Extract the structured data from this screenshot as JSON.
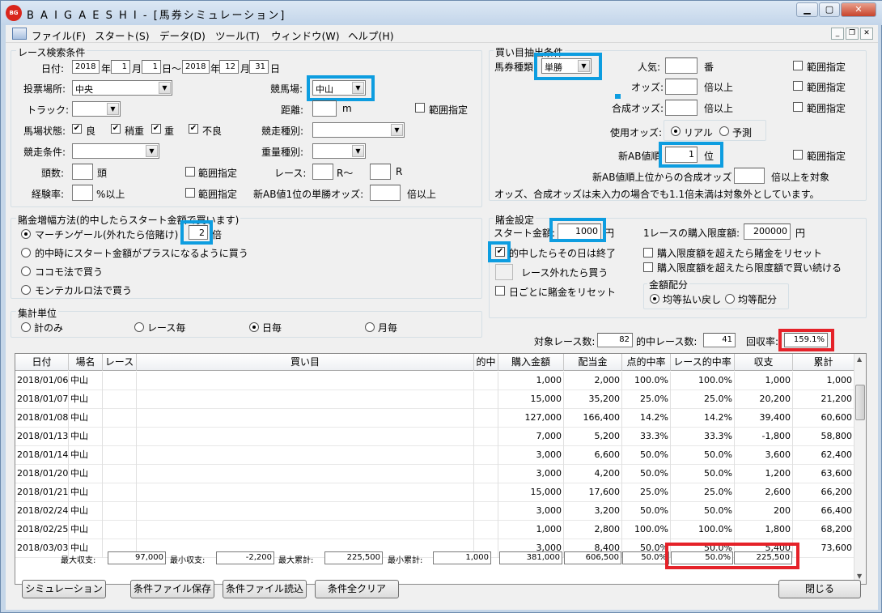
{
  "window": {
    "title": "B A I G A E S H I - [馬券シミュレーション]",
    "logo_text": "BAIGAESHI"
  },
  "menu": [
    "ファイル(F)",
    "スタート(S)",
    "データ(D)",
    "ツール(T)",
    "ウィンドウ(W)",
    "ヘルプ(H)"
  ],
  "race_search": {
    "title": "レース検索条件",
    "date_label": "日付:",
    "from": {
      "year": "2018",
      "y": "年",
      "month": "1",
      "m": "月",
      "day": "1",
      "d": "日〜"
    },
    "to": {
      "year": "2018",
      "y": "年",
      "month": "12",
      "m": "月",
      "day": "31",
      "d": "日"
    },
    "venue_label": "投票場所:",
    "venue": "中央",
    "racecourse_label": "競馬場:",
    "racecourse": "中山",
    "track_label": "トラック:",
    "track": "",
    "distance_label": "距離:",
    "distance": "",
    "distance_unit": "m",
    "range_label": "範囲指定",
    "condition_label": "馬場状態:",
    "conditions": [
      {
        "label": "良",
        "checked": true
      },
      {
        "label": "稍重",
        "checked": true
      },
      {
        "label": "重",
        "checked": true
      },
      {
        "label": "不良",
        "checked": true
      }
    ],
    "race_type_label": "競走種別:",
    "race_type": "",
    "race_cond_label": "競走条件:",
    "race_cond": "",
    "weight_label": "重量種別:",
    "weight": "",
    "heads_label": "頭数:",
    "heads": "",
    "heads_unit": "頭",
    "race_label": "レース:",
    "race_from": "",
    "race_mid": "R〜",
    "race_to": "",
    "race_unit": "R",
    "exp_label": "経験率:",
    "exp": "",
    "exp_unit": "%以上",
    "newab_odds_label": "新AB値1位の単勝オッズ:",
    "newab_odds": "",
    "newab_odds_unit": "倍以上"
  },
  "bet_extract": {
    "title": "買い目抽出条件",
    "type_label": "馬券種類",
    "type": "単勝",
    "pop_label": "人気:",
    "pop": "",
    "pop_unit": "番",
    "odds_label": "オッズ:",
    "odds": "",
    "odds_unit": "倍以上",
    "comp_label": "合成オッズ:",
    "comp": "",
    "comp_unit": "倍以上",
    "use_odds_label": "使用オッズ:",
    "use_real": "リアル",
    "use_pred": "予測",
    "newab_rank_label": "新AB値順",
    "newab_rank": "1",
    "newab_rank_unit": "位",
    "newab_comp_label": "新AB値順上位からの合成オッズ",
    "newab_comp": "",
    "newab_comp_unit": "倍以上を対象",
    "note": "オッズ、合成オッズは未入力の場合でも1.1倍未満は対象外としています。",
    "range_label": "範囲指定"
  },
  "stake_increase": {
    "title": "賭金増幅方法(的中したらスタート金額で買います)",
    "options": [
      "マーチンゲール(外れたら倍賭け)",
      "的中時にスタート金額がプラスになるように買う",
      "ココモ法で買う",
      "モンテカルロ法で買う"
    ],
    "multiplier": "2",
    "multiplier_unit": "倍"
  },
  "stake_settings": {
    "title": "賭金設定",
    "start_label": "スタート金額:",
    "start": "1000",
    "start_unit": "円",
    "limit_label": "1レースの購入限度額:",
    "limit": "200000",
    "limit_unit": "円",
    "end_on_hit": "的中したらその日は終了",
    "race_skip": "レース外れたら買う",
    "reset_daily": "日ごとに賭金をリセット",
    "reset_over": "購入限度額を超えたら賭金をリセット",
    "keep_limit": "購入限度額を超えたら限度額で買い続ける",
    "alloc_title": "金額配分",
    "alloc_eq_return": "均等払い戻し",
    "alloc_eq": "均等配分"
  },
  "agg_unit": {
    "title": "集計単位",
    "options": [
      "計のみ",
      "レース毎",
      "日毎",
      "月毎"
    ]
  },
  "summary": {
    "target_label": "対象レース数:",
    "target": "82",
    "hit_label": "的中レース数:",
    "hit": "41",
    "return_label": "回収率:",
    "return": "159.1%"
  },
  "table": {
    "headers": [
      "日付",
      "場名",
      "レース",
      "買い目",
      "的中",
      "購入金額",
      "配当金",
      "点的中率",
      "レース的中率",
      "収支",
      "累計"
    ],
    "rows": [
      [
        "2018/01/06",
        "中山",
        "",
        "",
        "",
        "1,000",
        "2,000",
        "100.0%",
        "100.0%",
        "1,000",
        "1,000"
      ],
      [
        "2018/01/07",
        "中山",
        "",
        "",
        "",
        "15,000",
        "35,200",
        "25.0%",
        "25.0%",
        "20,200",
        "21,200"
      ],
      [
        "2018/01/08",
        "中山",
        "",
        "",
        "",
        "127,000",
        "166,400",
        "14.2%",
        "14.2%",
        "39,400",
        "60,600"
      ],
      [
        "2018/01/13",
        "中山",
        "",
        "",
        "",
        "7,000",
        "5,200",
        "33.3%",
        "33.3%",
        "-1,800",
        "58,800"
      ],
      [
        "2018/01/14",
        "中山",
        "",
        "",
        "",
        "3,000",
        "6,600",
        "50.0%",
        "50.0%",
        "3,600",
        "62,400"
      ],
      [
        "2018/01/20",
        "中山",
        "",
        "",
        "",
        "3,000",
        "4,200",
        "50.0%",
        "50.0%",
        "1,200",
        "63,600"
      ],
      [
        "2018/01/21",
        "中山",
        "",
        "",
        "",
        "15,000",
        "17,600",
        "25.0%",
        "25.0%",
        "2,600",
        "66,200"
      ],
      [
        "2018/02/24",
        "中山",
        "",
        "",
        "",
        "3,000",
        "3,200",
        "50.0%",
        "50.0%",
        "200",
        "66,400"
      ],
      [
        "2018/02/25",
        "中山",
        "",
        "",
        "",
        "1,000",
        "2,800",
        "100.0%",
        "100.0%",
        "1,800",
        "68,200"
      ],
      [
        "2018/03/03",
        "中山",
        "",
        "",
        "",
        "3,000",
        "8,400",
        "50.0%",
        "50.0%",
        "5,400",
        "73,600"
      ]
    ]
  },
  "footer": {
    "max_profit_label": "最大収支:",
    "max_profit": "97,000",
    "min_profit_label": "最小収支:",
    "min_profit": "-2,200",
    "max_cum_label": "最大累計:",
    "max_cum": "225,500",
    "min_cum_label": "最小累計:",
    "min_cum": "1,000",
    "total_buy": "381,000",
    "total_pay": "606,500",
    "point_hit": "50.0%",
    "race_hit": "50.0%",
    "total_profit": "225,500"
  },
  "buttons": {
    "simulate": "シミュレーション",
    "save": "条件ファイル保存",
    "load": "条件ファイル読込",
    "clear": "条件全クリア",
    "close": "閉じる"
  }
}
